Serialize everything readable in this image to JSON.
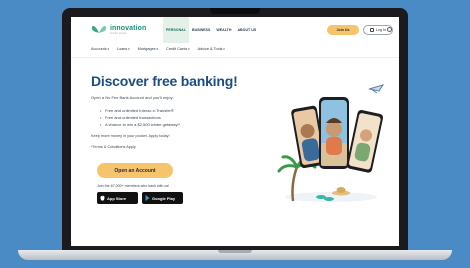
{
  "header": {
    "logo_text": "innovation",
    "logo_sub": "credit union",
    "nav": [
      {
        "label": "PERSONAL",
        "active": true
      },
      {
        "label": "BUSINESS",
        "active": false
      },
      {
        "label": "WEALTH",
        "active": false
      },
      {
        "label": "ABOUT US",
        "active": false
      }
    ],
    "join_label": "Join Us",
    "login_label": "Log In"
  },
  "subnav": [
    "Accounts",
    "Loans",
    "Mortgages",
    "Credit Cards",
    "Advice & Tools"
  ],
  "hero": {
    "title": "Discover free banking!",
    "intro": "Open a No Fee Bank Account and you'll enjoy:",
    "bullets": [
      "Free and unlimited Interac e-Transfer®",
      "Free and unlimited transactions",
      "A chance to win a $2,500 winter getaway!*"
    ],
    "keep_text": "Keep more money in your pocket. Apply today!",
    "terms": "*Terms & Conditions Apply",
    "cta_label": "Open an Account",
    "join_text": "Join the 67,000+ members who bank with us!"
  },
  "badges": {
    "app_store": "App Store",
    "google_play": "Google Play"
  },
  "colors": {
    "background": "#4a8bc5",
    "brand_green": "#1f8f7a",
    "title_blue": "#1b4e80",
    "cta_yellow": "#f5c46c"
  }
}
